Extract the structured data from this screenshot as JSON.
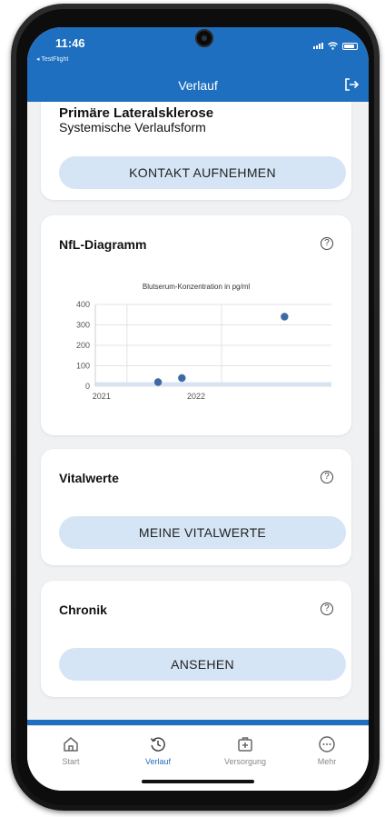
{
  "status": {
    "time": "11:46",
    "back_app": "◂ TestFlight"
  },
  "header": {
    "title": "Verlauf"
  },
  "diagnosis_card": {
    "name": "Primäre Lateralsklerose",
    "course": "Systemische Verlaufsform",
    "button_label": "KONTAKT AUFNEHMEN"
  },
  "nfl_card": {
    "title": "NfL-Diagramm",
    "help": "?",
    "chart_data": {
      "type": "scatter",
      "title": "Blutserum-Konzentration in pg/ml",
      "xlabel": "",
      "ylabel": "",
      "ylim": [
        0,
        400
      ],
      "yticks": [
        "400",
        "300",
        "200",
        "100",
        "0"
      ],
      "xticks": [
        "2021",
        "2022"
      ],
      "points": [
        {
          "x": "2021-05",
          "y": 20
        },
        {
          "x": "2021-08",
          "y": 40
        },
        {
          "x": "2022-09",
          "y": 340
        }
      ],
      "reference_band": [
        0,
        20
      ],
      "grid": true,
      "colors": {
        "point": "#3d6aa5",
        "band": "#d5e5f6",
        "grid": "#e3e3e3"
      }
    }
  },
  "vitals_card": {
    "title": "Vitalwerte",
    "help": "?",
    "button_label": "MEINE VITALWERTE"
  },
  "chronicle_card": {
    "title": "Chronik",
    "help": "?",
    "button_label": "ANSEHEN"
  },
  "tabbar": {
    "tabs": [
      {
        "label": "Start",
        "icon": "home-icon",
        "active": false
      },
      {
        "label": "Verlauf",
        "icon": "history-icon",
        "active": true
      },
      {
        "label": "Versorgung",
        "icon": "medical-kit-icon",
        "active": false
      },
      {
        "label": "Mehr",
        "icon": "more-icon",
        "active": false
      }
    ]
  },
  "colors": {
    "brand": "#1e6fc0",
    "button_bg": "#d5e5f6",
    "page_bg": "#f0f1f3"
  }
}
